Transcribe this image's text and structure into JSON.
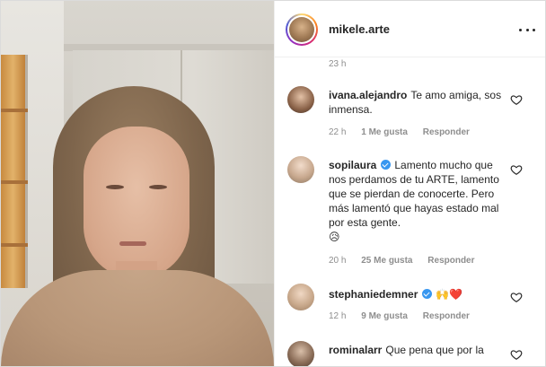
{
  "post": {
    "username": "mikele.arte",
    "top_timestamp": "23 h"
  },
  "comments": [
    {
      "username": "ivana.alejandro",
      "verified": false,
      "text": "Te amo amiga, sos inmensa.",
      "time": "22 h",
      "likes": "1 Me gusta",
      "reply": "Responder"
    },
    {
      "username": "sopilaura",
      "verified": true,
      "text": "Lamento mucho que nos perdamos de tu ARTE, lamento que se pierdan de conocerte. Pero más lamentó que hayas estado mal por esta gente.",
      "emoji": "😥",
      "time": "20 h",
      "likes": "25 Me gusta",
      "reply": "Responder"
    },
    {
      "username": "stephaniedemner",
      "verified": true,
      "text": "",
      "emoji": "🙌❤️",
      "time": "12 h",
      "likes": "9 Me gusta",
      "reply": "Responder"
    },
    {
      "username": "rominalarr",
      "verified": false,
      "text": "Que pena que por la"
    }
  ],
  "icons": {
    "more": "more-options-icon",
    "like": "heart-outline-icon",
    "verified": "verified-badge-icon"
  },
  "colors": {
    "verified_blue": "#3897f0",
    "meta_gray": "#8e8e8e",
    "text": "#262626"
  }
}
